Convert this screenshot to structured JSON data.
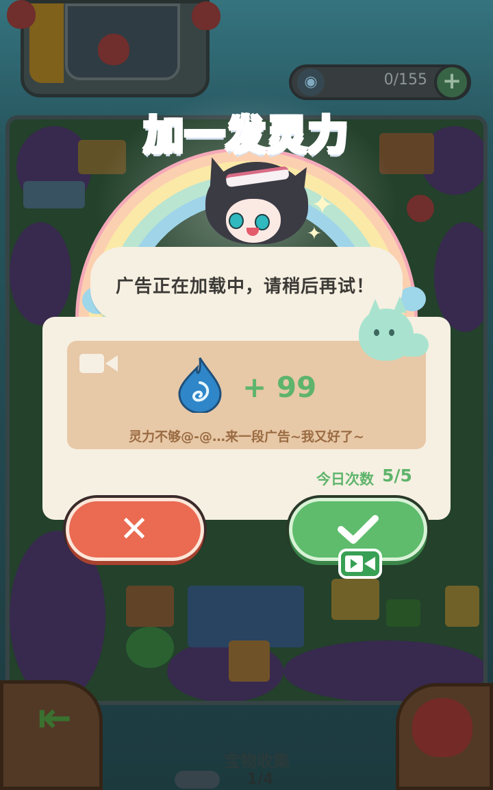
{
  "popup": {
    "title": "加一发灵力",
    "message": "广告正在加载中，请稍后再试！",
    "reward_amount": "+ 99",
    "reward_description": "灵力不够@-@…来一段广告~我又好了~",
    "today_label": "今日次数",
    "today_value": "5/5",
    "cancel_icon": "close-icon",
    "confirm_icon": "check-icon",
    "confirm_badge_icon": "video-icon"
  },
  "top_bar": {
    "counter_value": "0/155",
    "counter_icon": "spirit-drop-icon",
    "add_icon": "plus-icon"
  },
  "bottom": {
    "title": "宝物收集",
    "page": "1/4",
    "exit_icon": "exit-icon",
    "treasure_icon": "treasure-bag-icon"
  },
  "colors": {
    "title_blue": "#2d5db8",
    "accent_green": "#5eb46c",
    "cancel_red": "#ea6a52",
    "panel_cream": "#f6f0e2",
    "reward_tan": "#e7c8a7",
    "desc_brown": "#9a6b42"
  }
}
